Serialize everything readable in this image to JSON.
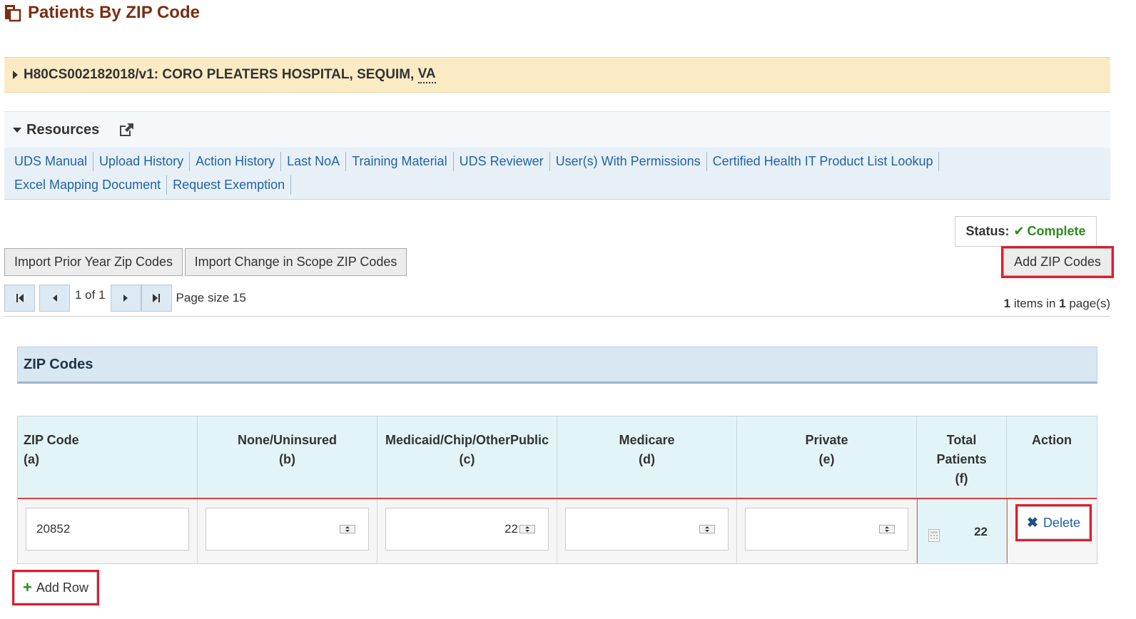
{
  "page": {
    "title": "Patients By ZIP Code"
  },
  "grant": {
    "id_prefix": "H80CS002182018/v1: CORO PLEATERS HOSPITAL, SEQUIM, ",
    "state": "VA"
  },
  "resources": {
    "title": "Resources",
    "links": [
      "UDS Manual",
      "Upload History",
      "Action History",
      "Last NoA",
      "Training Material",
      "UDS Reviewer",
      "User(s) With Permissions",
      "Certified Health IT Product List Lookup",
      "Excel Mapping Document",
      "Request Exemption"
    ]
  },
  "status": {
    "label": "Status:",
    "value": "Complete",
    "color": "#2d8a1e"
  },
  "toolbar": {
    "import_prior": "Import Prior Year Zip Codes",
    "import_scope": "Import Change in Scope ZIP Codes",
    "add_zip": "Add ZIP Codes"
  },
  "pager": {
    "page_info": "1 of 1",
    "page_size": "Page size 15",
    "items_count": "1",
    "items_text": " items in ",
    "pages_count": "1",
    "pages_text": " page(s)"
  },
  "zip_section": {
    "title": "ZIP Codes"
  },
  "table": {
    "columns": [
      {
        "name": "ZIP Code",
        "code": "(a)"
      },
      {
        "name": "None/Uninsured",
        "code": "(b)"
      },
      {
        "name": "Medicaid/Chip/OtherPublic",
        "code": "(c)"
      },
      {
        "name": "Medicare",
        "code": "(d)"
      },
      {
        "name": "Private",
        "code": "(e)"
      },
      {
        "name": "Total",
        "name2": "Patients",
        "code": "(f)"
      },
      {
        "name": "Action"
      }
    ],
    "rows": [
      {
        "zip": "20852",
        "none": "",
        "medicaid": "22",
        "medicare": "",
        "private": "",
        "total": "22",
        "action": "Delete"
      }
    ]
  },
  "add_row": "Add Row",
  "colors": {
    "accent_red": "#e11b2d",
    "link_blue": "#1f62a8",
    "title_brown": "#7a2e12"
  }
}
